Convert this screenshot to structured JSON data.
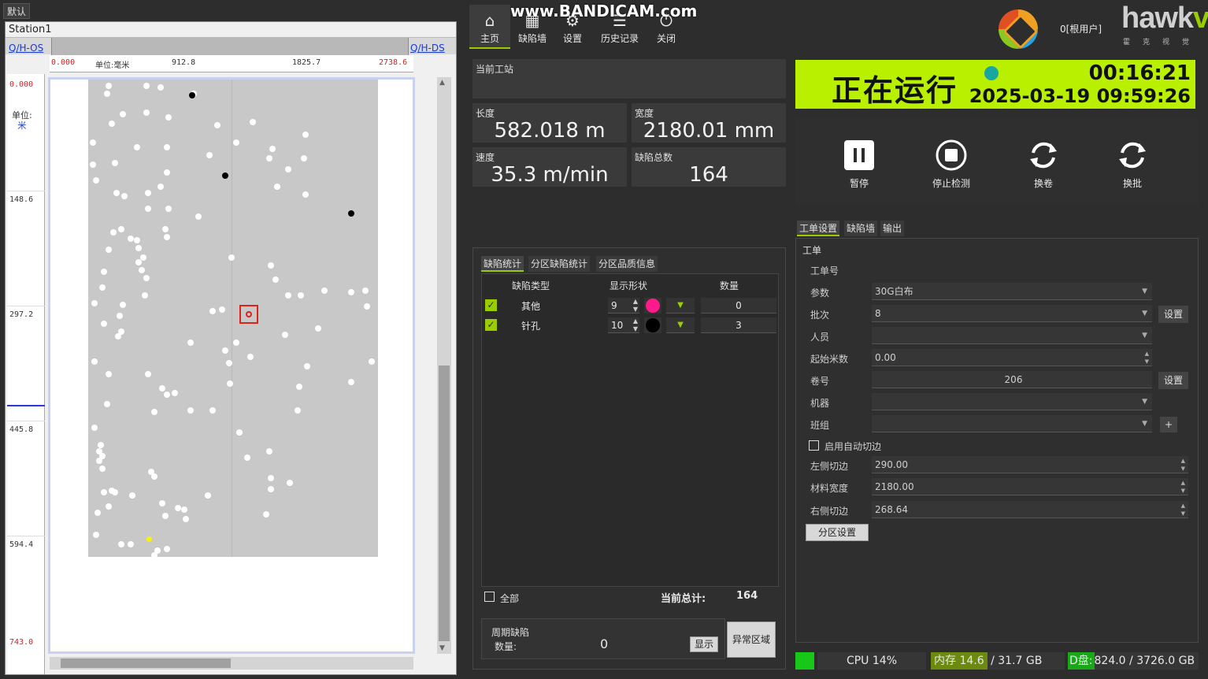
{
  "left": {
    "tab": "默认",
    "station": "Station1",
    "qh_os": "Q/H-OS",
    "qh_ds": "Q/H-DS",
    "ruler_top": [
      "0.000",
      "单位:毫米",
      "912.8",
      "1825.7",
      "2738.6"
    ],
    "ruler_left": [
      "0.000",
      "148.6",
      "297.2",
      "445.8",
      "594.4",
      "743.0"
    ],
    "unit_label": "单位:",
    "unit_value": "米"
  },
  "nav": {
    "watermark": "www.BANDICAM.com",
    "items": [
      {
        "label": "主页",
        "icon": "home-icon",
        "glyph": "⌂"
      },
      {
        "label": "缺陷墙",
        "icon": "grid-icon",
        "glyph": "▦"
      },
      {
        "label": "设置",
        "icon": "gear-icon",
        "glyph": "⚙"
      },
      {
        "label": "历史记录",
        "icon": "history-list-icon",
        "glyph": "☰"
      },
      {
        "label": "关闭",
        "icon": "power-icon",
        "glyph": "⏻"
      }
    ]
  },
  "brand": {
    "user": "0[根用户]",
    "name_a": "hawk",
    "name_b": "vis",
    "sub": "霍克视觉"
  },
  "info": {
    "station_label": "当前工站",
    "length_label": "长度",
    "length_value": "582.018 m",
    "width_label": "宽度",
    "width_value": "2180.01 mm",
    "speed_label": "速度",
    "speed_value": "35.3 m/min",
    "total_label": "缺陷总数",
    "total_value": "164"
  },
  "defects": {
    "tabs": [
      "缺陷统计",
      "分区缺陷统计",
      "分区品质信息"
    ],
    "headers": [
      "缺陷类型",
      "显示形状",
      "数量"
    ],
    "rows": [
      {
        "name": "其他",
        "shape": "9",
        "color": "#ff1a8c",
        "count": "0"
      },
      {
        "name": "针孔",
        "shape": "10",
        "color": "#000000",
        "count": "3"
      }
    ],
    "all_label": "全部",
    "current_total_label": "当前总计:",
    "current_total_value": "164",
    "period_title": "周期缺陷",
    "period_count_label": "数量:",
    "period_count_value": "0",
    "show_btn": "显示",
    "abnormal_btn": "异常区域"
  },
  "status": {
    "state": "正在运行",
    "timer": "00:16:21",
    "datetime": "2025-03-19 09:59:26",
    "dot_color": "#1aa6a0",
    "bg_color": "#b8f000"
  },
  "controls": [
    {
      "label": "暂停",
      "icon": "pause-icon"
    },
    {
      "label": "停止检测",
      "icon": "stop-icon"
    },
    {
      "label": "换卷",
      "icon": "roll-change-icon"
    },
    {
      "label": "换批",
      "icon": "batch-change-icon"
    }
  ],
  "form": {
    "tabs": [
      "工单设置",
      "缺陷墙",
      "输出"
    ],
    "title": "工单",
    "order_no_label": "工单号",
    "param_label": "参数",
    "param_value": "30G白布",
    "batch_label": "批次",
    "batch_value": "8",
    "set_btn": "设置",
    "staff_label": "人员",
    "staff_value": "",
    "start_m_label": "起始米数",
    "start_m_value": "0.00",
    "roll_label": "卷号",
    "roll_value": "206",
    "machine_label": "机器",
    "machine_value": "",
    "team_label": "班组",
    "team_value": "",
    "plus_btn": "+",
    "auto_trim_label": "启用自动切边",
    "left_trim_label": "左侧切边",
    "left_trim_value": "290.00",
    "mat_width_label": "材料宽度",
    "mat_width_value": "2180.00",
    "right_trim_label": "右侧切边",
    "right_trim_value": "268.64",
    "zone_btn": "分区设置"
  },
  "system": {
    "cpu": "CPU 14%",
    "mem_used": "内存 14.6",
    "mem_total": " / 31.7 GB",
    "disk_used": "D盘:",
    "disk_rest": "824.0 / 3726.0 GB"
  }
}
